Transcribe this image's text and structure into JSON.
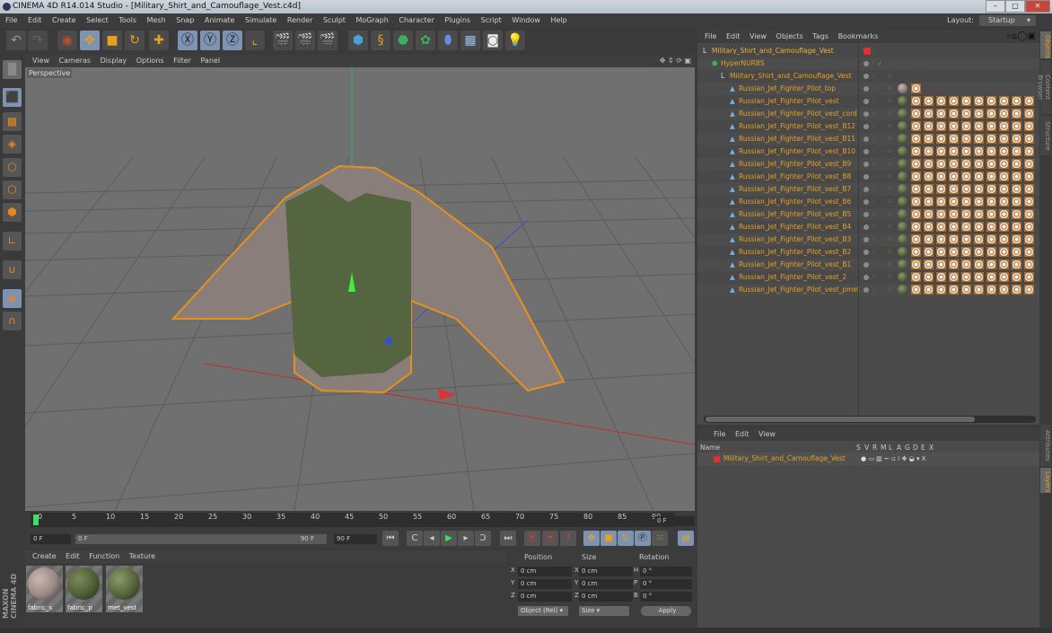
{
  "window": {
    "title": "CINEMA 4D R14.014 Studio - [Military_Shirt_and_Camouflage_Vest.c4d]",
    "minimize": "–",
    "maximize": "□",
    "close": "✕"
  },
  "menubar": {
    "items": [
      "File",
      "Edit",
      "Create",
      "Select",
      "Tools",
      "Mesh",
      "Snap",
      "Animate",
      "Simulate",
      "Render",
      "Sculpt",
      "MoGraph",
      "Character",
      "Plugins",
      "Script",
      "Window",
      "Help"
    ],
    "layout_label": "Layout:",
    "layout_value": "Startup"
  },
  "toolbar": {
    "icons": [
      "undo-icon",
      "redo-icon",
      "live-selection-icon",
      "move-icon",
      "scale-icon",
      "rotate-icon",
      "add-icon",
      "x-axis-icon",
      "y-axis-icon",
      "z-axis-icon",
      "coordinate-system-icon",
      "render-view-icon",
      "render-picture-viewer-icon",
      "render-settings-icon",
      "cube-icon",
      "spline-pen-icon",
      "subdivision-icon",
      "array-icon",
      "deformer-icon",
      "floor-icon",
      "camera-icon",
      "light-icon"
    ]
  },
  "left_tools": {
    "icons": [
      "make-editable-icon",
      "model-mode-icon",
      "texture-mode-icon",
      "workplane-icon",
      "points-mode-icon",
      "edges-mode-icon",
      "polygons-mode-icon",
      "axis-mode-icon",
      "magnet-icon",
      "workplane-lock-icon",
      "snap-icon"
    ]
  },
  "viewport": {
    "menu": [
      "View",
      "Cameras",
      "Display",
      "Options",
      "Filter",
      "Panel"
    ],
    "label": "Perspective"
  },
  "timeline": {
    "ticks": [
      "0",
      "5",
      "10",
      "15",
      "20",
      "25",
      "30",
      "35",
      "40",
      "45",
      "50",
      "55",
      "60",
      "65",
      "70",
      "75",
      "80",
      "85",
      "90"
    ],
    "current_frame": "0 F",
    "start_frame": "0 F",
    "range_start": "0 F",
    "range_end": "90 F",
    "end_frame": "90 F"
  },
  "materials": {
    "menu": [
      "Create",
      "Edit",
      "Function",
      "Texture"
    ],
    "items": [
      {
        "name": "fabric_s",
        "color": "#9a8a84"
      },
      {
        "name": "fabric_p",
        "color": "#4f5e36"
      },
      {
        "name": "met_vest",
        "color": "#55653b"
      }
    ]
  },
  "coordinates": {
    "headers": [
      "Position",
      "Size",
      "Rotation"
    ],
    "rows": [
      {
        "pos_axis": "X",
        "pos": "0 cm",
        "size_axis": "X",
        "size": "0 cm",
        "rot_axis": "H",
        "rot": "0 °"
      },
      {
        "pos_axis": "Y",
        "pos": "0 cm",
        "size_axis": "Y",
        "size": "0 cm",
        "rot_axis": "P",
        "rot": "0 °"
      },
      {
        "pos_axis": "Z",
        "pos": "0 cm",
        "size_axis": "Z",
        "size": "0 cm",
        "rot_axis": "B",
        "rot": "0 °"
      }
    ],
    "mode": "Object (Rel)",
    "size_mode": "Size",
    "apply": "Apply"
  },
  "object_manager": {
    "menu": [
      "File",
      "Edit",
      "View",
      "Objects",
      "Tags",
      "Bookmarks"
    ],
    "objects": [
      {
        "name": "Military_Shirt_and_Camouflage_Vest",
        "level": 0,
        "type": "null"
      },
      {
        "name": "HyperNURBS",
        "level": 1,
        "type": "hypernurbs"
      },
      {
        "name": "Military_Shirt_and_Camouflage_Vest",
        "level": 2,
        "type": "null"
      },
      {
        "name": "Russian_Jet_Fighter_Pilot_top",
        "level": 3,
        "type": "mesh"
      },
      {
        "name": "Russian_Jet_Fighter_Pilot_vest",
        "level": 3,
        "type": "mesh"
      },
      {
        "name": "Russian_Jet_Fighter_Pilot_vest_cord",
        "level": 3,
        "type": "mesh"
      },
      {
        "name": "Russian_Jet_Fighter_Pilot_vest_B12",
        "level": 3,
        "type": "mesh"
      },
      {
        "name": "Russian_Jet_Fighter_Pilot_vest_B11",
        "level": 3,
        "type": "mesh"
      },
      {
        "name": "Russian_Jet_Fighter_Pilot_vest_B10",
        "level": 3,
        "type": "mesh"
      },
      {
        "name": "Russian_Jet_Fighter_Pilot_vest_B9",
        "level": 3,
        "type": "mesh"
      },
      {
        "name": "Russian_Jet_Fighter_Pilot_vest_B8",
        "level": 3,
        "type": "mesh"
      },
      {
        "name": "Russian_Jet_Fighter_Pilot_vest_B7",
        "level": 3,
        "type": "mesh"
      },
      {
        "name": "Russian_Jet_Fighter_Pilot_vest_B6",
        "level": 3,
        "type": "mesh"
      },
      {
        "name": "Russian_Jet_Fighter_Pilot_vest_B5",
        "level": 3,
        "type": "mesh"
      },
      {
        "name": "Russian_Jet_Fighter_Pilot_vest_B4",
        "level": 3,
        "type": "mesh"
      },
      {
        "name": "Russian_Jet_Fighter_Pilot_vest_B3",
        "level": 3,
        "type": "mesh"
      },
      {
        "name": "Russian_Jet_Fighter_Pilot_vest_B2",
        "level": 3,
        "type": "mesh"
      },
      {
        "name": "Russian_Jet_Fighter_Pilot_vest_B1",
        "level": 3,
        "type": "mesh"
      },
      {
        "name": "Russian_Jet_Fighter_Pilot_vest_2",
        "level": 3,
        "type": "mesh"
      },
      {
        "name": "Russian_Jet_Fighter_Pilot_vest_pmet",
        "level": 3,
        "type": "mesh"
      }
    ]
  },
  "layers": {
    "menu": [
      "File",
      "Edit",
      "View"
    ],
    "columns": [
      "Name",
      "S",
      "V",
      "R",
      "M",
      "L",
      "A",
      "G",
      "D",
      "E",
      "X"
    ],
    "items": [
      {
        "name": "Military_Shirt_and_Camouflage_Vest",
        "color": "#e03030"
      }
    ]
  },
  "side_tabs": {
    "top": [
      "Objects",
      "Content Browser",
      "Structure"
    ],
    "bottom": [
      "Attributes",
      "Layers"
    ]
  },
  "colors": {
    "accent": "#e8a020",
    "selected_tool": "#7e92b2",
    "layer_red": "#e03030"
  }
}
